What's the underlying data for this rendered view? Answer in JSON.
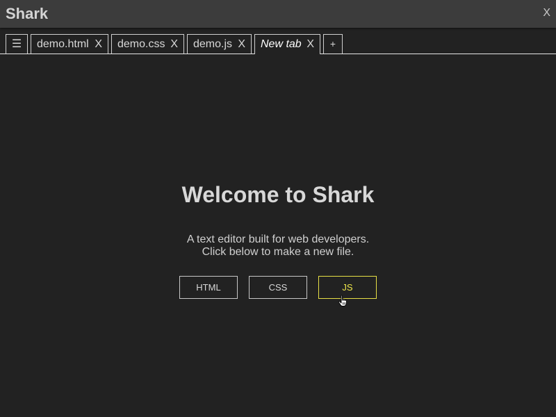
{
  "window": {
    "title": "Shark",
    "close_label": "X"
  },
  "tabs": {
    "menu_icon": "hamburger-menu-icon",
    "menu_glyph": "☰",
    "items": [
      {
        "label": "demo.html",
        "close": "X",
        "active": false
      },
      {
        "label": "demo.css",
        "close": "X",
        "active": false
      },
      {
        "label": "demo.js",
        "close": "X",
        "active": false
      },
      {
        "label": "New tab",
        "close": "X",
        "active": true
      }
    ],
    "add_label": "+"
  },
  "welcome": {
    "title": "Welcome to Shark",
    "line1": "A text editor built for web developers.",
    "line2": "Click below to make a new file."
  },
  "new_file_buttons": [
    {
      "label": "HTML",
      "hovered": false
    },
    {
      "label": "CSS",
      "hovered": false
    },
    {
      "label": "JS",
      "hovered": true
    }
  ],
  "colors": {
    "background": "#222222",
    "titlebar": "#3c3c3c",
    "text": "#d8d8d8",
    "hover_accent": "#f0e84a"
  },
  "cursor": "hand-pointer-icon"
}
